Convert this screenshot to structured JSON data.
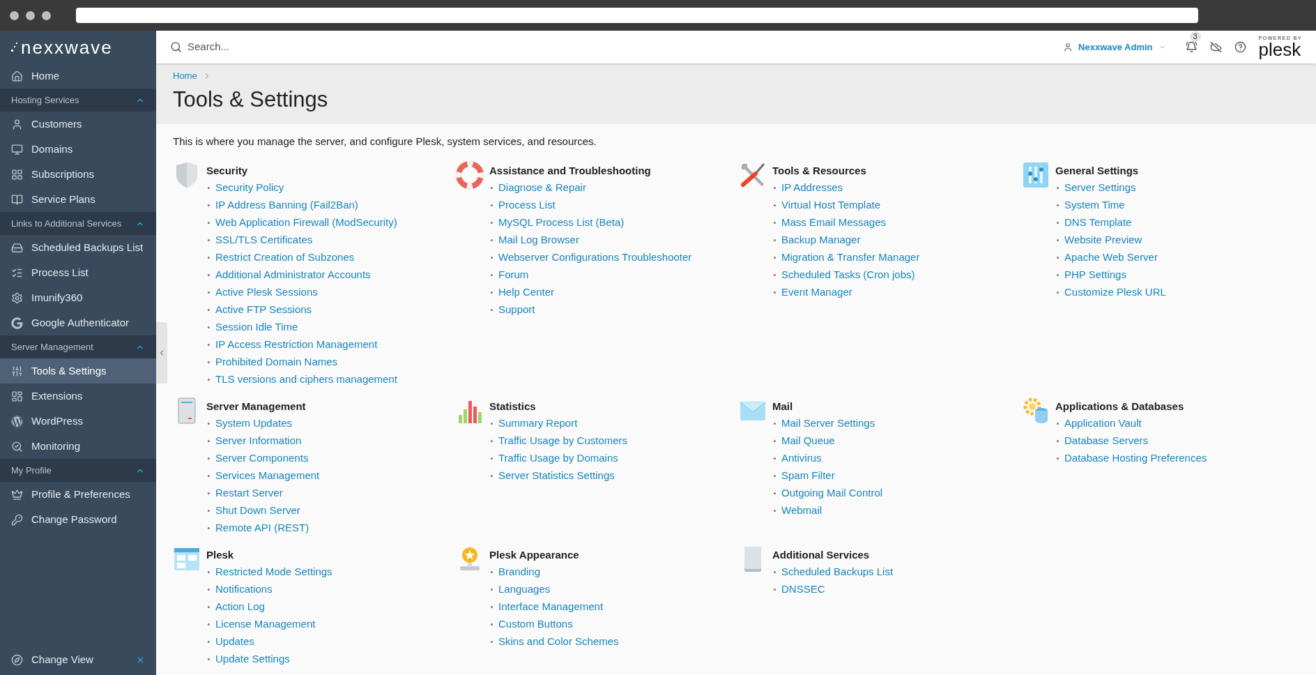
{
  "sidebar": {
    "logo": "nexxwave",
    "entries": [
      {
        "kind": "item",
        "label": "Home",
        "selected": false
      },
      {
        "kind": "group",
        "title": "Hosting Services",
        "expanded": true,
        "items": [
          {
            "label": "Customers",
            "selected": false
          },
          {
            "label": "Domains",
            "selected": false
          },
          {
            "label": "Subscriptions",
            "selected": false
          },
          {
            "label": "Service Plans",
            "selected": false
          }
        ]
      },
      {
        "kind": "group",
        "title": "Links to Additional Services",
        "expanded": true,
        "items": [
          {
            "label": "Scheduled Backups List",
            "selected": false
          },
          {
            "label": "Process List",
            "selected": false
          },
          {
            "label": "Imunify360",
            "selected": false
          },
          {
            "label": "Google Authenticator",
            "selected": false
          }
        ]
      },
      {
        "kind": "group",
        "title": "Server Management",
        "expanded": true,
        "items": [
          {
            "label": "Tools & Settings",
            "selected": true
          },
          {
            "label": "Extensions",
            "selected": false
          },
          {
            "label": "WordPress",
            "selected": false
          },
          {
            "label": "Monitoring",
            "selected": false
          }
        ]
      },
      {
        "kind": "group",
        "title": "My Profile",
        "expanded": true,
        "items": [
          {
            "label": "Profile & Preferences",
            "selected": false
          },
          {
            "label": "Change Password",
            "selected": false
          }
        ]
      }
    ],
    "footer": {
      "label": "Change View"
    }
  },
  "header": {
    "search": {
      "placeholder": "Search..."
    },
    "user": "Nexxwave Admin",
    "notifications": "3",
    "powered_by": "POWERED BY",
    "brand": "plesk"
  },
  "breadcrumb": [
    "Home"
  ],
  "title": "Tools & Settings",
  "description": "This is where you manage the server, and configure Plesk, system services, and resources.",
  "sections": [
    {
      "title": "Security",
      "links": [
        "Security Policy",
        "IP Address Banning (Fail2Ban)",
        "Web Application Firewall (ModSecurity)",
        "SSL/TLS Certificates",
        "Restrict Creation of Subzones",
        "Additional Administrator Accounts",
        "Active Plesk Sessions",
        "Active FTP Sessions",
        "Session Idle Time",
        "IP Access Restriction Management",
        "Prohibited Domain Names",
        "TLS versions and ciphers management"
      ]
    },
    {
      "title": "Assistance and Troubleshooting",
      "links": [
        "Diagnose & Repair",
        "Process List",
        "MySQL Process List (Beta)",
        "Mail Log Browser",
        "Webserver Configurations Troubleshooter",
        "Forum",
        "Help Center",
        "Support"
      ]
    },
    {
      "title": "Tools & Resources",
      "links": [
        "IP Addresses",
        "Virtual Host Template",
        "Mass Email Messages",
        "Backup Manager",
        "Migration & Transfer Manager",
        "Scheduled Tasks (Cron jobs)",
        "Event Manager"
      ]
    },
    {
      "title": "General Settings",
      "links": [
        "Server Settings",
        "System Time",
        "DNS Template",
        "Website Preview",
        "Apache Web Server",
        "PHP Settings",
        "Customize Plesk URL"
      ]
    },
    {
      "title": "Server Management",
      "links": [
        "System Updates",
        "Server Information",
        "Server Components",
        "Services Management",
        "Restart Server",
        "Shut Down Server",
        "Remote API (REST)"
      ]
    },
    {
      "title": "Statistics",
      "links": [
        "Summary Report",
        "Traffic Usage by Customers",
        "Traffic Usage by Domains",
        "Server Statistics Settings"
      ]
    },
    {
      "title": "Mail",
      "links": [
        "Mail Server Settings",
        "Mail Queue",
        "Antivirus",
        "Spam Filter",
        "Outgoing Mail Control",
        "Webmail"
      ]
    },
    {
      "title": "Applications & Databases",
      "links": [
        "Application Vault",
        "Database Servers",
        "Database Hosting Preferences"
      ]
    },
    {
      "title": "Plesk",
      "links": [
        "Restricted Mode Settings",
        "Notifications",
        "Action Log",
        "License Management",
        "Updates",
        "Update Settings"
      ]
    },
    {
      "title": "Plesk Appearance",
      "links": [
        "Branding",
        "Languages",
        "Interface Management",
        "Custom Buttons",
        "Skins and Color Schemes"
      ]
    },
    {
      "title": "Additional Services",
      "links": [
        "Scheduled Backups List",
        "DNSSEC"
      ]
    }
  ]
}
